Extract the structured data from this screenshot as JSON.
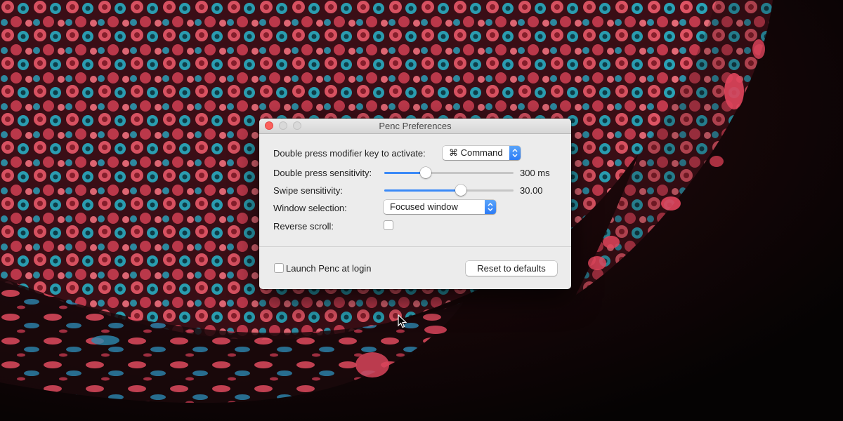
{
  "window": {
    "title": "Penc Preferences"
  },
  "settings": {
    "activation_key": {
      "label": "Double press modifier key to activate:",
      "value": "⌘ Command"
    },
    "double_press_sensitivity": {
      "label": "Double press sensitivity:",
      "value_text": "300 ms",
      "slider_fraction": 0.32
    },
    "swipe_sensitivity": {
      "label": "Swipe sensitivity:",
      "value_text": "30.00",
      "slider_fraction": 0.59
    },
    "window_selection": {
      "label": "Window selection:",
      "value": "Focused window"
    },
    "reverse_scroll": {
      "label": "Reverse scroll:",
      "checked": false
    }
  },
  "footer": {
    "launch_at_login_label": "Launch Penc at login",
    "launch_at_login_checked": false,
    "reset_button_label": "Reset to defaults"
  },
  "colors": {
    "accent": "#3b8af7",
    "close_button": "#fc605c",
    "window_background": "#ececec"
  }
}
